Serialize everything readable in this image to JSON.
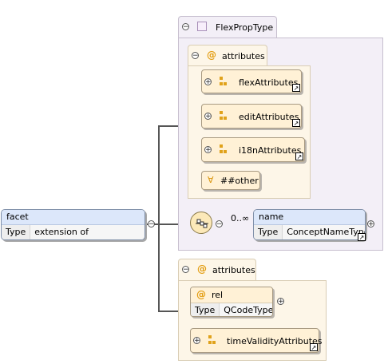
{
  "facet": {
    "name": "facet",
    "type_key": "Type",
    "type_value": "extension of 'FlexPropType'"
  },
  "flexproptype": {
    "label": "FlexPropType"
  },
  "top_attributes": {
    "label": "attributes",
    "items": [
      {
        "label": "flexAttributes"
      },
      {
        "label": "editAttributes"
      },
      {
        "label": "i18nAttributes"
      }
    ],
    "any_other": {
      "symbol": "∀",
      "label": "##other"
    }
  },
  "sequence": {
    "multiplicity": "0..∞"
  },
  "name_element": {
    "name": "name",
    "type_key": "Type",
    "type_value": "ConceptNameType"
  },
  "bottom_attributes": {
    "label": "attributes",
    "rel": {
      "name": "rel",
      "type_key": "Type",
      "type_value": "QCodeType"
    },
    "items": [
      {
        "label": "timeValidityAttributes"
      }
    ]
  },
  "glyphs": {
    "collapse": "−",
    "expand": "+",
    "at": "@",
    "ref": "↗"
  },
  "colors": {
    "lilac_panel": "#f3eff7",
    "cream_panel": "#fdf6e8",
    "item_fill": "#fff1d6",
    "element_header": "#dce7fa",
    "icon_orange": "#e0a21b"
  }
}
